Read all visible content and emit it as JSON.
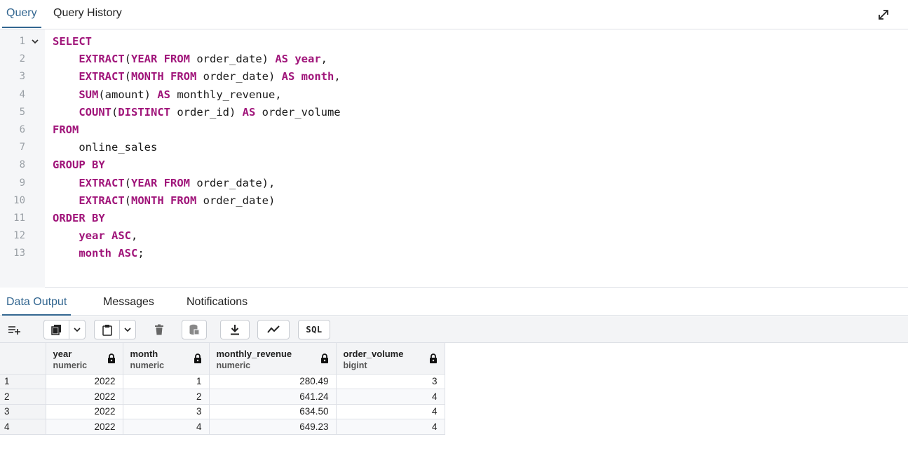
{
  "top_tabs": [
    "Query",
    "Query History"
  ],
  "editor": {
    "lines": [
      {
        "n": "1",
        "segs": [
          [
            "kw",
            "SELECT"
          ]
        ]
      },
      {
        "n": "2",
        "segs": [
          [
            "",
            "    "
          ],
          [
            "fn",
            "EXTRACT"
          ],
          [
            "",
            "("
          ],
          [
            "kw",
            "YEAR FROM"
          ],
          [
            "",
            " order_date) "
          ],
          [
            "kw",
            "AS"
          ],
          [
            "kw",
            " year"
          ],
          [
            "",
            ","
          ]
        ]
      },
      {
        "n": "3",
        "segs": [
          [
            "",
            "    "
          ],
          [
            "fn",
            "EXTRACT"
          ],
          [
            "",
            "("
          ],
          [
            "kw",
            "MONTH FROM"
          ],
          [
            "",
            " order_date) "
          ],
          [
            "kw",
            "AS"
          ],
          [
            "kw",
            " month"
          ],
          [
            "",
            ","
          ]
        ]
      },
      {
        "n": "4",
        "segs": [
          [
            "",
            "    "
          ],
          [
            "fn",
            "SUM"
          ],
          [
            "",
            "(amount) "
          ],
          [
            "kw",
            "AS"
          ],
          [
            "",
            " monthly_revenue,"
          ]
        ]
      },
      {
        "n": "5",
        "segs": [
          [
            "",
            "    "
          ],
          [
            "fn",
            "COUNT"
          ],
          [
            "",
            "("
          ],
          [
            "kw",
            "DISTINCT"
          ],
          [
            "",
            " order_id) "
          ],
          [
            "kw",
            "AS"
          ],
          [
            "",
            " order_volume"
          ]
        ]
      },
      {
        "n": "6",
        "segs": [
          [
            "kw",
            "FROM"
          ]
        ]
      },
      {
        "n": "7",
        "segs": [
          [
            "",
            "    online_sales"
          ]
        ]
      },
      {
        "n": "8",
        "segs": [
          [
            "kw",
            "GROUP BY"
          ]
        ]
      },
      {
        "n": "9",
        "segs": [
          [
            "",
            "    "
          ],
          [
            "fn",
            "EXTRACT"
          ],
          [
            "",
            "("
          ],
          [
            "kw",
            "YEAR FROM"
          ],
          [
            "",
            " order_date),"
          ]
        ]
      },
      {
        "n": "10",
        "segs": [
          [
            "",
            "    "
          ],
          [
            "fn",
            "EXTRACT"
          ],
          [
            "",
            "("
          ],
          [
            "kw",
            "MONTH FROM"
          ],
          [
            "",
            " order_date)"
          ]
        ]
      },
      {
        "n": "11",
        "segs": [
          [
            "kw",
            "ORDER BY"
          ]
        ]
      },
      {
        "n": "12",
        "segs": [
          [
            "",
            "    "
          ],
          [
            "kw",
            "year ASC"
          ],
          [
            "",
            ","
          ]
        ]
      },
      {
        "n": "13",
        "segs": [
          [
            "",
            "    "
          ],
          [
            "kw",
            "month ASC"
          ],
          [
            "",
            ";"
          ]
        ]
      }
    ]
  },
  "output_tabs": [
    "Data Output",
    "Messages",
    "Notifications"
  ],
  "toolbar": {
    "sql_label": "SQL"
  },
  "columns": [
    {
      "name": "year",
      "type": "numeric"
    },
    {
      "name": "month",
      "type": "numeric"
    },
    {
      "name": "monthly_revenue",
      "type": "numeric"
    },
    {
      "name": "order_volume",
      "type": "bigint"
    }
  ],
  "rows": [
    {
      "n": "1",
      "cells": [
        "2022",
        "1",
        "280.49",
        "3"
      ]
    },
    {
      "n": "2",
      "cells": [
        "2022",
        "2",
        "641.24",
        "4"
      ]
    },
    {
      "n": "3",
      "cells": [
        "2022",
        "3",
        "634.50",
        "4"
      ]
    },
    {
      "n": "4",
      "cells": [
        "2022",
        "4",
        "649.23",
        "4"
      ]
    }
  ],
  "colors": {
    "keyword": "#a0157a",
    "accent": "#326690"
  }
}
